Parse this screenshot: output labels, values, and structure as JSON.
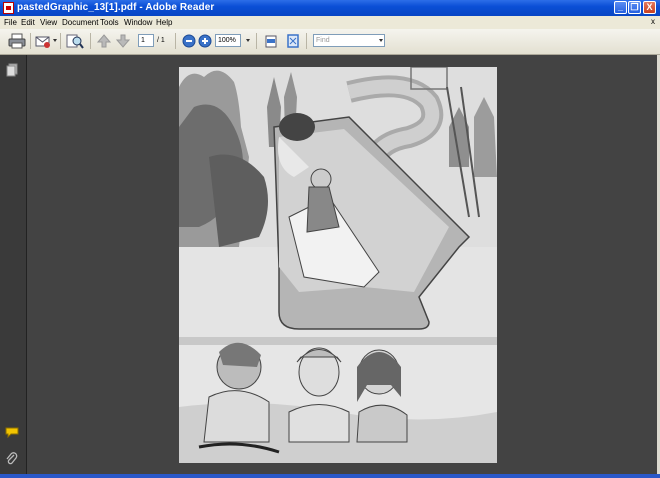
{
  "window": {
    "title": "pastedGraphic_13[1].pdf - Adobe Reader",
    "controls": [
      "_",
      "❐",
      "X"
    ]
  },
  "menu": {
    "items": [
      "File",
      "Edit",
      "View",
      "Document",
      "Tools",
      "Window",
      "Help"
    ],
    "close_glyph": "x"
  },
  "toolbar": {
    "page_number": "1",
    "page_total": "/ 1",
    "zoom": "100%",
    "find_placeholder": "Find"
  },
  "icons": {
    "print": "printer-icon",
    "email": "email-icon",
    "search": "search-icon",
    "prev_page": "up-arrow-icon",
    "next_page": "down-arrow-icon",
    "zoom_out": "zoom-out-icon",
    "zoom_in": "zoom-in-icon",
    "fit_width": "fit-width-icon",
    "fit_page": "fit-page-icon",
    "pages_panel": "pages-icon",
    "comments_panel": "comment-icon",
    "attachments_panel": "paperclip-icon"
  },
  "colors": {
    "titlebar": "#0b4fd6",
    "menubar": "#ece9d8",
    "document_bg": "#434343"
  }
}
